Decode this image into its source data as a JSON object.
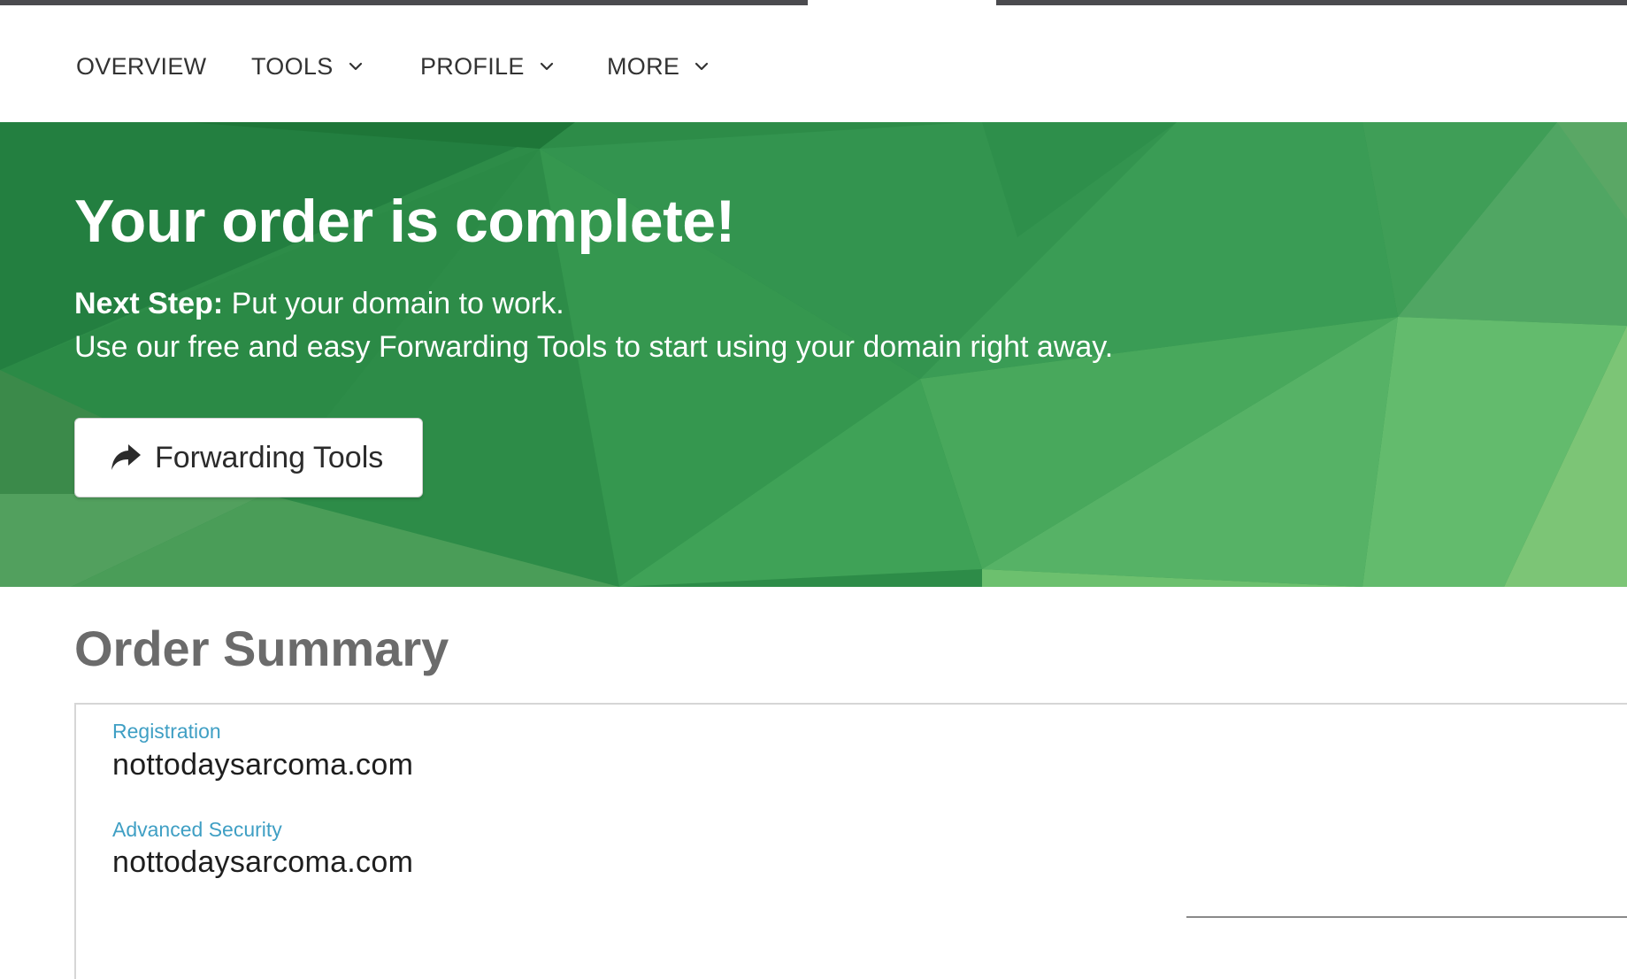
{
  "nav": {
    "items": [
      {
        "label": "OVERVIEW",
        "has_dropdown": false
      },
      {
        "label": "TOOLS",
        "has_dropdown": true
      },
      {
        "label": "PROFILE",
        "has_dropdown": true
      },
      {
        "label": "MORE",
        "has_dropdown": true
      }
    ],
    "dropdown_icon": "chevron-down-icon"
  },
  "hero": {
    "title": "Your order is complete!",
    "next_step_label": "Next Step:",
    "next_step_text": " Put your domain to work.",
    "description": "Use our free and easy Forwarding Tools to start using your domain right away.",
    "button": {
      "label": "Forwarding Tools",
      "icon": "share-forward-icon"
    }
  },
  "order_summary": {
    "title": "Order Summary",
    "items": [
      {
        "type": "Registration",
        "domain": "nottodaysarcoma.com"
      },
      {
        "type": "Advanced Security",
        "domain": "nottodaysarcoma.com"
      }
    ]
  },
  "colors": {
    "hero_green": "#2f8f4a",
    "hero_green_light": "#7cc576",
    "label_blue": "#3f9fc4",
    "nav_text": "#333333",
    "top_strip": "#4b4b4f"
  }
}
